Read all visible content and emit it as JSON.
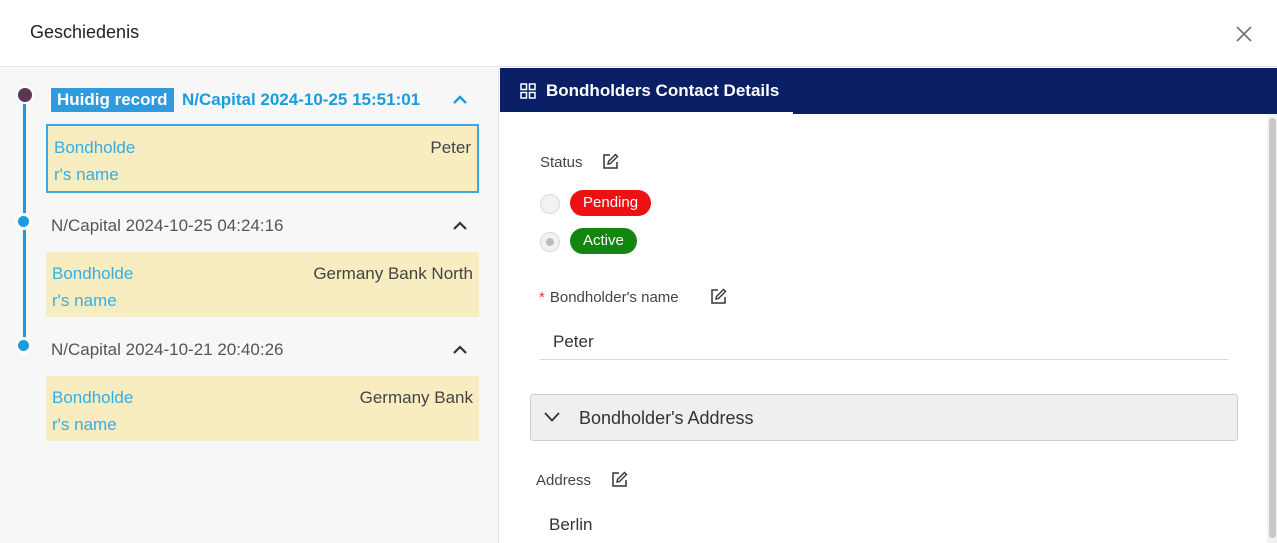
{
  "header": {
    "title": "Geschiedenis",
    "close_icon": "close-icon"
  },
  "history": {
    "current": {
      "badge": "Huidig record",
      "title": "N/Capital 2024-10-25 15:51:01",
      "field_label": "Bondholder's name",
      "field_label_lines": [
        "Bondholde",
        "r's name"
      ],
      "field_value": "Peter"
    },
    "past": [
      {
        "title": "N/Capital 2024-10-25 04:24:16",
        "field_label_lines": [
          "Bondholde",
          "r's name"
        ],
        "field_value": "Germany Bank North"
      },
      {
        "title": "N/Capital 2024-10-21 20:40:26",
        "field_label_lines": [
          "Bondholde",
          "r's name"
        ],
        "field_value": "Germany Bank"
      }
    ]
  },
  "details": {
    "tab_label": "Bondholders Contact Details",
    "tab_icon": "grid-icon",
    "status": {
      "label": "Status",
      "options": [
        {
          "label": "Pending",
          "color": "#ee1111",
          "selected": false
        },
        {
          "label": "Active",
          "color": "#12860f",
          "selected": true
        }
      ]
    },
    "name": {
      "required_mark": "*",
      "label": "Bondholder's name",
      "value": "Peter"
    },
    "address_section": {
      "label": "Bondholder's Address",
      "expanded": true
    },
    "address": {
      "label": "Address",
      "value": "Berlin"
    }
  },
  "colors": {
    "accent": "#1a9be0",
    "tab_bar": "#0b1f66",
    "card_bg": "#f8ecc1",
    "current_dot": "#5b3655"
  }
}
